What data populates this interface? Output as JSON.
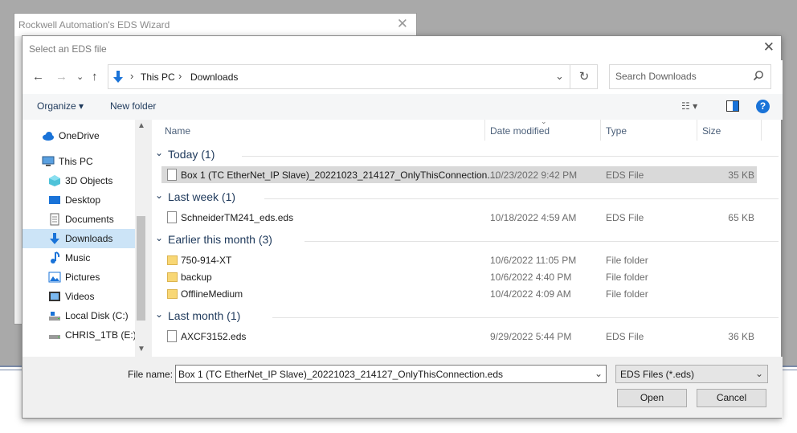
{
  "background_window": {
    "title": "Rockwell Automation's EDS Wizard"
  },
  "dialog": {
    "title": "Select an EDS file"
  },
  "address_bar": {
    "breadcrumbs": [
      "This PC",
      "Downloads"
    ],
    "separator": "›",
    "search_placeholder": "Search Downloads"
  },
  "toolbar": {
    "organize": "Organize ▾",
    "new_folder": "New folder",
    "help": "?"
  },
  "nav": {
    "items": [
      {
        "label": "OneDrive",
        "icon": "cloud-icon"
      },
      {
        "label": "This PC",
        "icon": "computer-icon"
      },
      {
        "label": "3D Objects",
        "icon": "cube-icon"
      },
      {
        "label": "Desktop",
        "icon": "desktop-icon"
      },
      {
        "label": "Documents",
        "icon": "documents-icon"
      },
      {
        "label": "Downloads",
        "icon": "download-icon",
        "selected": true
      },
      {
        "label": "Music",
        "icon": "music-icon"
      },
      {
        "label": "Pictures",
        "icon": "pictures-icon"
      },
      {
        "label": "Videos",
        "icon": "videos-icon"
      },
      {
        "label": "Local Disk (C:)",
        "icon": "drive-icon"
      },
      {
        "label": "CHRIS_1TB (E:)",
        "icon": "drive-icon"
      }
    ]
  },
  "columns": {
    "name": "Name",
    "date": "Date modified",
    "type": "Type",
    "size": "Size"
  },
  "groups": [
    {
      "label": "Today (1)",
      "files": [
        {
          "name": "Box 1 (TC EtherNet_IP Slave)_20221023_214127_OnlyThisConnection....",
          "date": "10/23/2022 9:42 PM",
          "type": "EDS File",
          "size": "35 KB",
          "kind": "file",
          "selected": true
        }
      ]
    },
    {
      "label": "Last week (1)",
      "files": [
        {
          "name": "SchneiderTM241_eds.eds",
          "date": "10/18/2022 4:59 AM",
          "type": "EDS File",
          "size": "65 KB",
          "kind": "file"
        }
      ]
    },
    {
      "label": "Earlier this month (3)",
      "files": [
        {
          "name": "750-914-XT",
          "date": "10/6/2022 11:05 PM",
          "type": "File folder",
          "size": "",
          "kind": "folder"
        },
        {
          "name": "backup",
          "date": "10/6/2022 4:40 PM",
          "type": "File folder",
          "size": "",
          "kind": "folder"
        },
        {
          "name": "OfflineMedium",
          "date": "10/4/2022 4:09 AM",
          "type": "File folder",
          "size": "",
          "kind": "folder"
        }
      ]
    },
    {
      "label": "Last month (1)",
      "files": [
        {
          "name": "AXCF3152.eds",
          "date": "9/29/2022 5:44 PM",
          "type": "EDS File",
          "size": "36 KB",
          "kind": "file"
        }
      ]
    }
  ],
  "footer": {
    "file_name_label": "File name:",
    "file_name_value": "Box 1 (TC EtherNet_IP Slave)_20221023_214127_OnlyThisConnection.eds",
    "file_type": "EDS Files (*.eds)",
    "open": "Open",
    "cancel": "Cancel"
  },
  "colors": {
    "accent": "#1a73d8",
    "selection": "#cce4f7",
    "row_selected": "#d9d9d9",
    "group_text": "#1e395b"
  }
}
